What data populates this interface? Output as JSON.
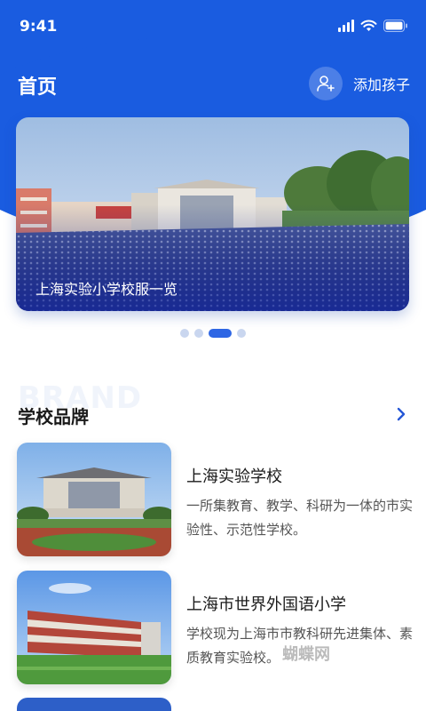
{
  "status": {
    "time": "9:41"
  },
  "header": {
    "title": "首页",
    "add_child_label": "添加孩子",
    "add_child_icon": "add-user-icon"
  },
  "banner": {
    "caption": "上海实验小学校服一览",
    "page_count": 4,
    "active_page": 3
  },
  "brand_section": {
    "watermark": "BRAND",
    "title": "学校品牌",
    "more_icon": "chevron-right-icon"
  },
  "schools": [
    {
      "name": "上海实验学校",
      "desc": "一所集教育、教学、科研为一体的市实验性、示范性学校。"
    },
    {
      "name": "上海市世界外国语小学",
      "desc": "学校现为上海市市教科研先进集体、素质教育实验校。"
    }
  ],
  "watermark": "蝴蝶网",
  "colors": {
    "primary": "#1a5ce0",
    "dot_active": "#2e66e4",
    "dot_inactive": "#c9d6ef"
  }
}
